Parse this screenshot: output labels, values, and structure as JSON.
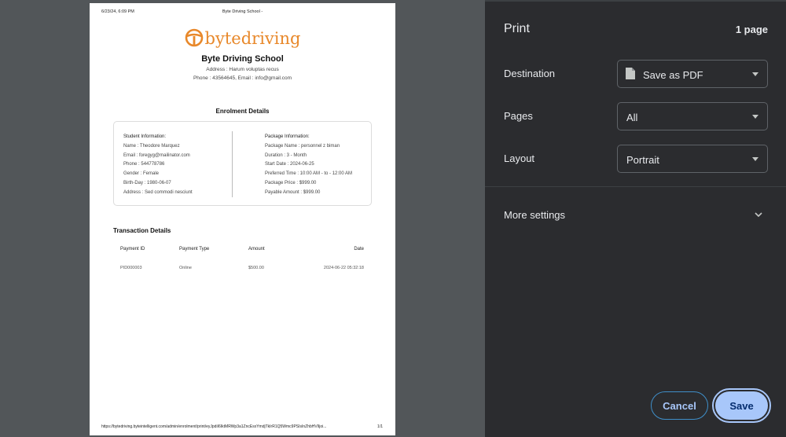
{
  "document": {
    "header_date": "6/23/24, 6:09 PM",
    "header_title": "Byte Driving School -",
    "logo_text_left": "byte",
    "logo_text_right": "driving",
    "school_name": "Byte Driving School",
    "address": "Address : Harum voluptas recus",
    "contact": "Phone : 43564645, Email : info@gmail.com",
    "enrolment_title": "Enrolment Details",
    "student": {
      "heading": "Student Information:",
      "lines": [
        "Name : Theodore Marquez",
        "Email : foregyg@mailinator.com",
        "Phone : 544778786",
        "Gender : Female",
        "Birth-Day : 1980-06-07",
        "Address : Sed commodi nesciunt"
      ]
    },
    "package": {
      "heading": "Package Information:",
      "lines": [
        "Package Name : personnel z biman",
        "Duration : 3 - Month",
        "Start Date : 2024-06-25",
        "Preferred Time : 10:00 AM - to - 12:00 AM",
        "Package Price : $999.00",
        "Payable Amount : $999.00"
      ]
    },
    "transaction_title": "Transaction Details",
    "transaction_headers": [
      "Payment ID",
      "Payment Type",
      "Amount",
      "Date"
    ],
    "transaction_rows": [
      [
        "PID000003",
        "Online",
        "$500.00",
        "2024-06-22 05:32:18"
      ]
    ],
    "footer_url": "https://bytedriving.byteintelligent.com/admin/enrolment/print/eyJpdiI6IktMRWp3a1ZncEsxYmdjTkIrR1Q5Wmc9PSIsInZhbHVlIjoi...",
    "footer_page": "1/1"
  },
  "panel": {
    "title": "Print",
    "page_count": "1 page",
    "destination_label": "Destination",
    "destination_value": "Save as PDF",
    "pages_label": "Pages",
    "pages_value": "All",
    "layout_label": "Layout",
    "layout_value": "Portrait",
    "more_settings": "More settings",
    "cancel_label": "Cancel",
    "save_label": "Save"
  },
  "colors": {
    "brand_orange": "#e8882a",
    "panel_bg": "#2b2c2f",
    "preview_bg": "#525659",
    "save_button": "#a8c7fa"
  },
  "icons": [
    "steering-wheel-logo-icon",
    "document-icon",
    "dropdown-arrow-icon",
    "chevron-down-icon"
  ]
}
